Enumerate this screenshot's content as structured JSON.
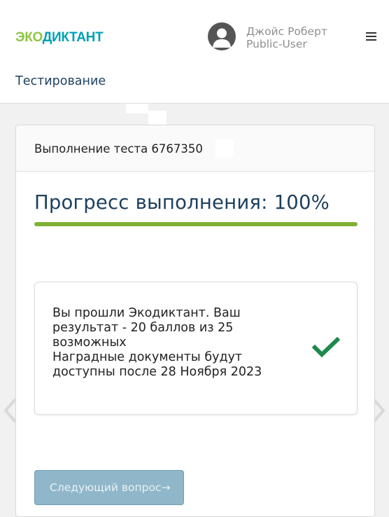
{
  "header": {
    "logo": {
      "part1": "ЭКО",
      "part2": "ДИКТАНТ"
    },
    "user": {
      "name": "Джойс Роберт",
      "role": "Public-User"
    },
    "icons": {
      "avatar": "user-avatar-icon",
      "menu": "hamburger-menu-icon"
    }
  },
  "section": {
    "title": "Тестирование"
  },
  "card": {
    "heading": "Выполнение теста 6767350",
    "progress": {
      "label": "Прогресс выполнения: 100%",
      "value": 100
    },
    "result": {
      "lines": [
        "Вы прошли Экодиктант. Ваш",
        "результат - 20 баллов из 25",
        "возможных",
        "Наградные документы будут",
        "доступны после 28 Ноября 2023"
      ],
      "icon": "checkmark-icon"
    },
    "next_button": "Следующий вопрос→"
  },
  "colors": {
    "accent_green": "#7fb034",
    "check_green": "#1e8a4c",
    "title_navy": "#1d3f5e",
    "button_blue": "#8fb7c9",
    "logo_green": "#8dc63f",
    "logo_teal": "#00a0b4"
  }
}
